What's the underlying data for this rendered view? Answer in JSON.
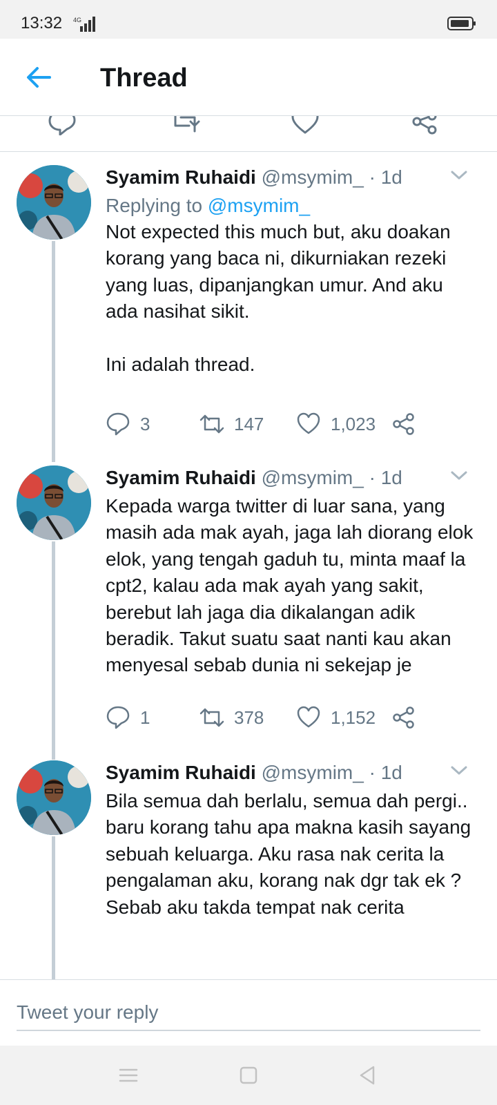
{
  "status_bar": {
    "time": "13:32",
    "network": "4G"
  },
  "header": {
    "title": "Thread"
  },
  "composer": {
    "placeholder": "Tweet your reply"
  },
  "tweets": [
    {
      "name": "Syamim Ruhaidi",
      "handle": "@msymim_",
      "separator": "·",
      "time": "1d",
      "replying_prefix": "Replying to",
      "replying_to": "@msymim_",
      "text": "Not expected this much but, aku doakan korang yang baca ni, dikurniakan rezeki yang luas, dipanjangkan umur. And aku ada nasihat sikit.\n\nIni adalah thread.",
      "replies": "3",
      "retweets": "147",
      "likes": "1,023"
    },
    {
      "name": "Syamim Ruhaidi",
      "handle": "@msymim_",
      "separator": "·",
      "time": "1d",
      "text": "Kepada warga twitter di luar sana, yang masih ada mak ayah, jaga lah diorang elok elok, yang tengah gaduh tu, minta maaf la cpt2, kalau ada mak ayah yang sakit, berebut lah jaga dia dikalangan adik beradik. Takut suatu saat nanti kau akan menyesal sebab dunia ni sekejap je",
      "replies": "1",
      "retweets": "378",
      "likes": "1,152"
    },
    {
      "name": "Syamim Ruhaidi",
      "handle": "@msymim_",
      "separator": "·",
      "time": "1d",
      "text": "Bila semua dah berlalu, semua dah pergi.. baru korang tahu apa makna kasih sayang sebuah keluarga. Aku rasa nak cerita la pengalaman aku, korang nak dgr tak ek ? Sebab aku takda tempat nak cerita"
    }
  ],
  "icons": {
    "back": "arrow-left-icon",
    "reply": "reply-icon",
    "retweet": "retweet-icon",
    "like": "heart-icon",
    "share": "share-icon",
    "menu": "chevron-down-icon"
  },
  "colors": {
    "accent": "#1da1f2",
    "secondary_text": "#657786",
    "divider": "#d7dde2",
    "thread_line": "#c4ced6"
  }
}
